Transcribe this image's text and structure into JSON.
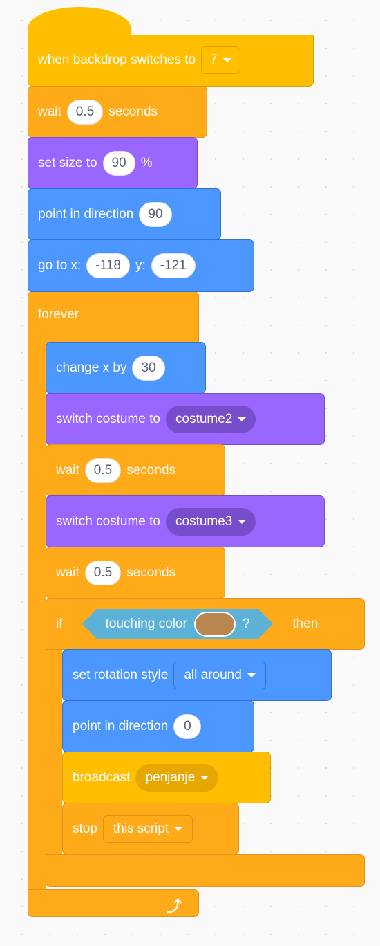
{
  "script": {
    "hat": {
      "label": "when backdrop switches to",
      "value": "7"
    },
    "wait1": {
      "label": "wait",
      "value": "0.5",
      "unit": "seconds"
    },
    "set_size": {
      "label": "set size to",
      "value": "90",
      "unit": "%"
    },
    "point1": {
      "label": "point in direction",
      "value": "90"
    },
    "goto": {
      "label_x": "go to x:",
      "x": "-118",
      "label_y": "y:",
      "y": "-121"
    },
    "forever": {
      "label": "forever",
      "loop_icon": "loop-arrow-icon"
    },
    "change_x": {
      "label": "change x by",
      "value": "30"
    },
    "costume2": {
      "label": "switch costume to",
      "value": "costume2"
    },
    "wait2": {
      "label": "wait",
      "value": "0.5",
      "unit": "seconds"
    },
    "costume3": {
      "label": "switch costume to",
      "value": "costume3"
    },
    "wait3": {
      "label": "wait",
      "value": "0.5",
      "unit": "seconds"
    },
    "if_block": {
      "label_if": "if",
      "condition": {
        "label": "touching color",
        "color": "#b8864e",
        "suffix": "?"
      },
      "label_then": "then"
    },
    "rotation": {
      "label": "set rotation style",
      "value": "all around"
    },
    "point2": {
      "label": "point in direction",
      "value": "0"
    },
    "broadcast": {
      "label": "broadcast",
      "value": "penjanje"
    },
    "stop": {
      "label": "stop",
      "value": "this script"
    }
  },
  "colors": {
    "events": "#ffbf00",
    "control": "#ffab19",
    "looks": "#9966ff",
    "motion": "#4c97ff",
    "sensing": "#5cb1d6"
  }
}
